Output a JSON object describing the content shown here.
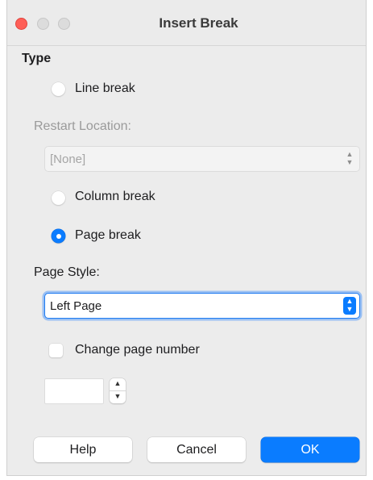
{
  "window": {
    "title": "Insert Break"
  },
  "type_section": {
    "title": "Type",
    "options": {
      "line_break": "Line break",
      "column_break": "Column break",
      "page_break": "Page break"
    },
    "selected": "page_break",
    "restart_location": {
      "label": "Restart Location:",
      "value": "[None]",
      "enabled": false
    },
    "page_style": {
      "label": "Page Style:",
      "value": "Left Page",
      "enabled": true
    },
    "change_page_number": {
      "label": "Change page number",
      "checked": false,
      "value": ""
    }
  },
  "buttons": {
    "help": "Help",
    "cancel": "Cancel",
    "ok": "OK"
  },
  "colors": {
    "accent": "#0a7cff",
    "close": "#ff5f57",
    "window_bg": "#ececec"
  },
  "icons": {
    "select_chevron": "up-down-chevron-icon",
    "stepper": "up-down-stepper-icon"
  }
}
